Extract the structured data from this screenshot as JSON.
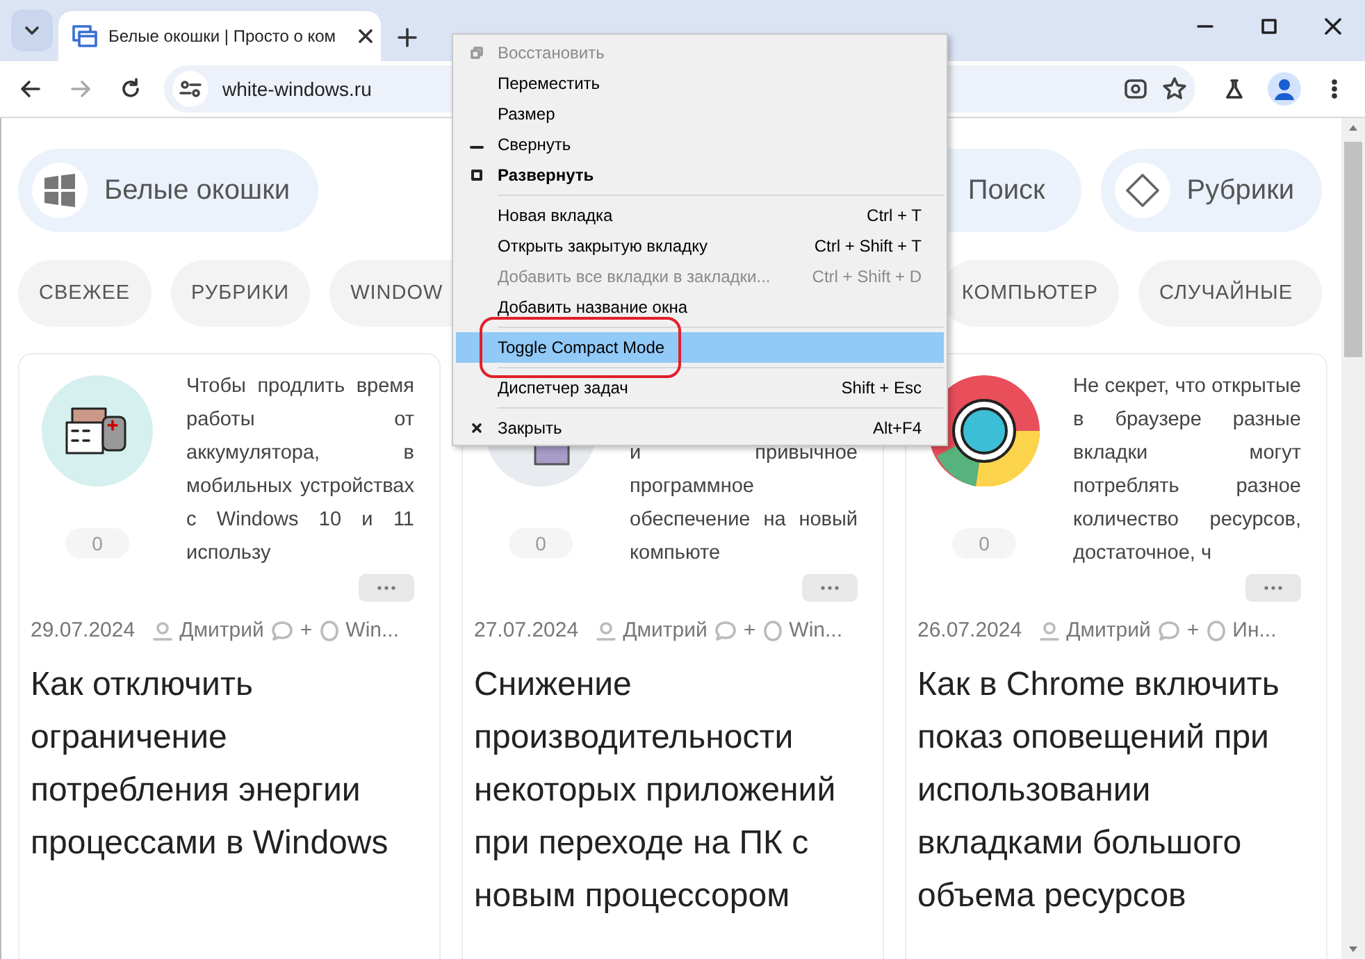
{
  "browser": {
    "tab_title": "Белые окошки | Просто о ком",
    "url": "white-windows.ru"
  },
  "site_header": {
    "logo": "Белые окошки",
    "search": "Поиск",
    "categories": "Рубрики"
  },
  "nav": [
    {
      "label": "СВЕЖЕЕ"
    },
    {
      "label": "РУБРИКИ"
    },
    {
      "label": "WINDOW"
    },
    {
      "label": "КОМПЬЮТЕР"
    },
    {
      "label": "СЛУЧАЙНЫЕ"
    }
  ],
  "posts": [
    {
      "excerpt": "Чтобы продлить время работы от аккумулятора, в мобильных устройствах с Windows 10 и 11 использу",
      "likes": "0",
      "date": "29.07.2024",
      "author": "Дмитрий",
      "comments": "+",
      "category": "Win...",
      "title": "Как отключить ограничение потребления энергии процессами в Windows"
    },
    {
      "excerpt": "и привычное программное обеспечение на новый компьюте",
      "likes": "0",
      "date": "27.07.2024",
      "author": "Дмитрий",
      "comments": "+",
      "category": "Win...",
      "title": "Снижение производительности некоторых приложений при переходе на ПК с новым процессором"
    },
    {
      "excerpt": "Не секрет, что открытые в браузере разные вкладки могут потреблять разное количество ресурсов, достаточное, ч",
      "likes": "0",
      "date": "26.07.2024",
      "author": "Дмитрий",
      "comments": "+",
      "category": "Ин...",
      "title": "Как в Chrome включить показ оповещений при использовании вкладками большого объема ресурсов"
    }
  ],
  "context_menu": {
    "items": [
      {
        "kind": "restore",
        "label": "Восстановить",
        "disabled": true,
        "bold": false,
        "selected": false
      },
      {
        "kind": "plain",
        "label": "Переместить",
        "disabled": false,
        "bold": false,
        "selected": false
      },
      {
        "kind": "plain",
        "label": "Размер",
        "disabled": false,
        "bold": false,
        "selected": false
      },
      {
        "kind": "minimize",
        "label": "Свернуть",
        "disabled": false,
        "bold": false,
        "selected": false
      },
      {
        "kind": "maximize",
        "label": "Развернуть",
        "disabled": false,
        "bold": true,
        "selected": false
      },
      {
        "kind": "separator"
      },
      {
        "kind": "plain",
        "label": "Новая вкладка",
        "shortcut": "Ctrl + T",
        "disabled": false,
        "bold": false,
        "selected": false
      },
      {
        "kind": "plain",
        "label": "Открыть закрытую вкладку",
        "shortcut": "Ctrl + Shift + T",
        "disabled": false,
        "bold": false,
        "selected": false
      },
      {
        "kind": "plain",
        "label": "Добавить все вкладки в закладки...",
        "shortcut": "Ctrl + Shift + D",
        "disabled": true,
        "bold": false,
        "selected": false
      },
      {
        "kind": "plain",
        "label": "Добавить название окна",
        "disabled": false,
        "bold": false,
        "selected": false
      },
      {
        "kind": "separator"
      },
      {
        "kind": "plain",
        "label": "Toggle Compact Mode",
        "disabled": false,
        "bold": false,
        "selected": true
      },
      {
        "kind": "separator"
      },
      {
        "kind": "plain",
        "label": "Диспетчер задач",
        "shortcut": "Shift + Esc",
        "disabled": false,
        "bold": false,
        "selected": false
      },
      {
        "kind": "separator"
      },
      {
        "kind": "close",
        "label": "Закрыть",
        "shortcut": "Alt+F4",
        "disabled": false,
        "bold": false,
        "selected": false
      }
    ]
  }
}
